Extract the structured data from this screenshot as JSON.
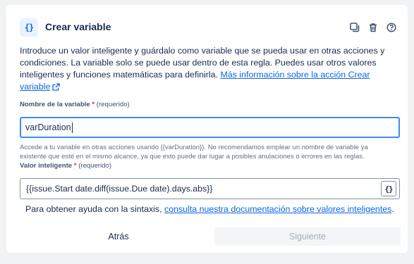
{
  "header": {
    "icon_text": "{}",
    "title": "Crear variable",
    "icons": [
      "duplicate-icon",
      "trash-icon",
      "help-icon"
    ]
  },
  "description": {
    "text": "Introduce un valor inteligente y guárdalo como variable que se pueda usar en otras acciones y condiciones. La variable solo se puede usar dentro de esta regla. Puedes usar otros valores inteligentes y funciones matemáticas para definirla. ",
    "link": "Más información sobre la acción Crear variable"
  },
  "variable_name": {
    "label": "Nombre de la variable",
    "required_mark": "*",
    "required_text": "(requerido)",
    "value": "varDuration",
    "help": "Accede a tu variable en otras acciones usando {{varDuration}}. No recomendamos emplear un nombre de variable ya existente que esté en el mismo alcance, ya que esto puede dar lugar a posibles anulaciones o errores en las reglas."
  },
  "smart_value": {
    "label": "Valor inteligente",
    "required_mark": "*",
    "required_text": "(requerido)",
    "value": "{{issue.Start date.diff(issue.Due date).days.abs}}",
    "button_icon": "{}"
  },
  "syntax_help": {
    "text": "Para obtener ayuda con la sintaxis, ",
    "link": "consulta nuestra documentación sobre valores inteligentes",
    "suffix": "."
  },
  "footer": {
    "back_label": "Atrás",
    "next_label": "Siguiente"
  },
  "colors": {
    "accent": "#0c66e4",
    "focus_border": "#388bff",
    "required": "#c9372c"
  }
}
